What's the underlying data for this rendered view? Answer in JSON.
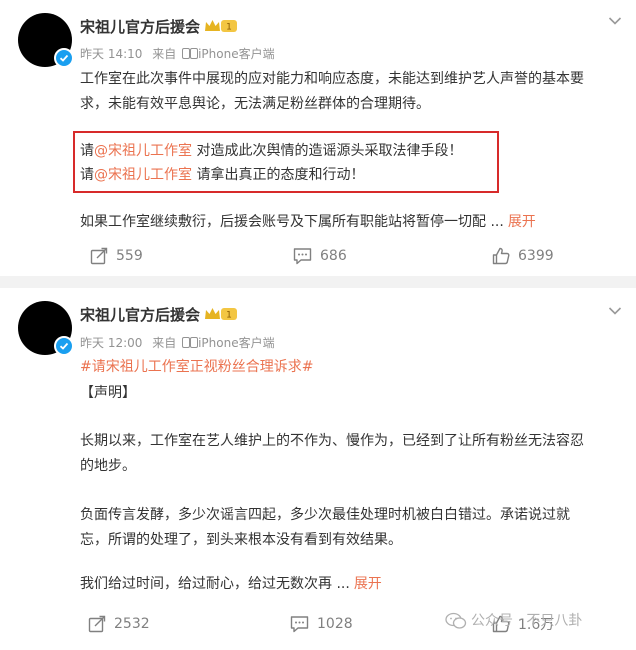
{
  "posts": [
    {
      "author": "宋祖儿官方后援会",
      "level_badge": "1",
      "time": "昨天 14:10",
      "source_prefix": "来自",
      "source": "iPhone客户端",
      "para1_line1": "工作室在此次事件中展现的应对能力和响应态度，未能达到维护艺人声誉的基本要",
      "para1_line2": "求，未能有效平息舆论，无法满足粉丝群体的合理期待。",
      "box_line1_prefix": "请",
      "box_line1_mention": "@宋祖儿工作室",
      "box_line1_rest": " 对造成此次舆情的造谣源头采取法律手段！",
      "box_line2_prefix": "请",
      "box_line2_mention": "@宋祖儿工作室",
      "box_line2_rest": " 请拿出真正的态度和行动！",
      "truncated_line": "如果工作室继续敷衍，后援会账号及下属所有职能站将暂停一切配 ...",
      "expand_label": "展开",
      "reposts": "559",
      "comments": "686",
      "likes": "6399"
    },
    {
      "author": "宋祖儿官方后援会",
      "level_badge": "1",
      "time": "昨天 12:00",
      "source_prefix": "来自",
      "source": "iPhone客户端",
      "hashtag": "#请宋祖儿工作室正视粉丝合理诉求#",
      "heading": "【声明】",
      "para1_line1": "长期以来，工作室在艺人维护上的不作为、慢作为，已经到了让所有粉丝无法容忍",
      "para1_line2": "的地步。",
      "para2_line1": "负面传言发酵，多少次谣言四起，多少次最佳处理时机被白白错过。承诺说过就",
      "para2_line2": "忘，所谓的处理了，到头来根本没有看到有效结果。",
      "truncated_line": "我们给过时间，给过耐心，给过无数次再 ...",
      "expand_label": "展开",
      "reposts": "2532",
      "comments": "1028",
      "likes": "1.6万"
    }
  ],
  "watermark": "公众号 · 不只八卦",
  "colors": {
    "link": "#eb7350",
    "verified": "#1a9ff0",
    "highlight_box": "#d72a2a",
    "background": "#f2f2f2"
  },
  "icons": {
    "more": "chevron-down-icon",
    "repost": "repost-icon",
    "comment": "comment-icon",
    "like": "like-icon",
    "verified": "verified-badge-icon",
    "source_device": "phone-icon",
    "watermark": "wechat-icon"
  }
}
